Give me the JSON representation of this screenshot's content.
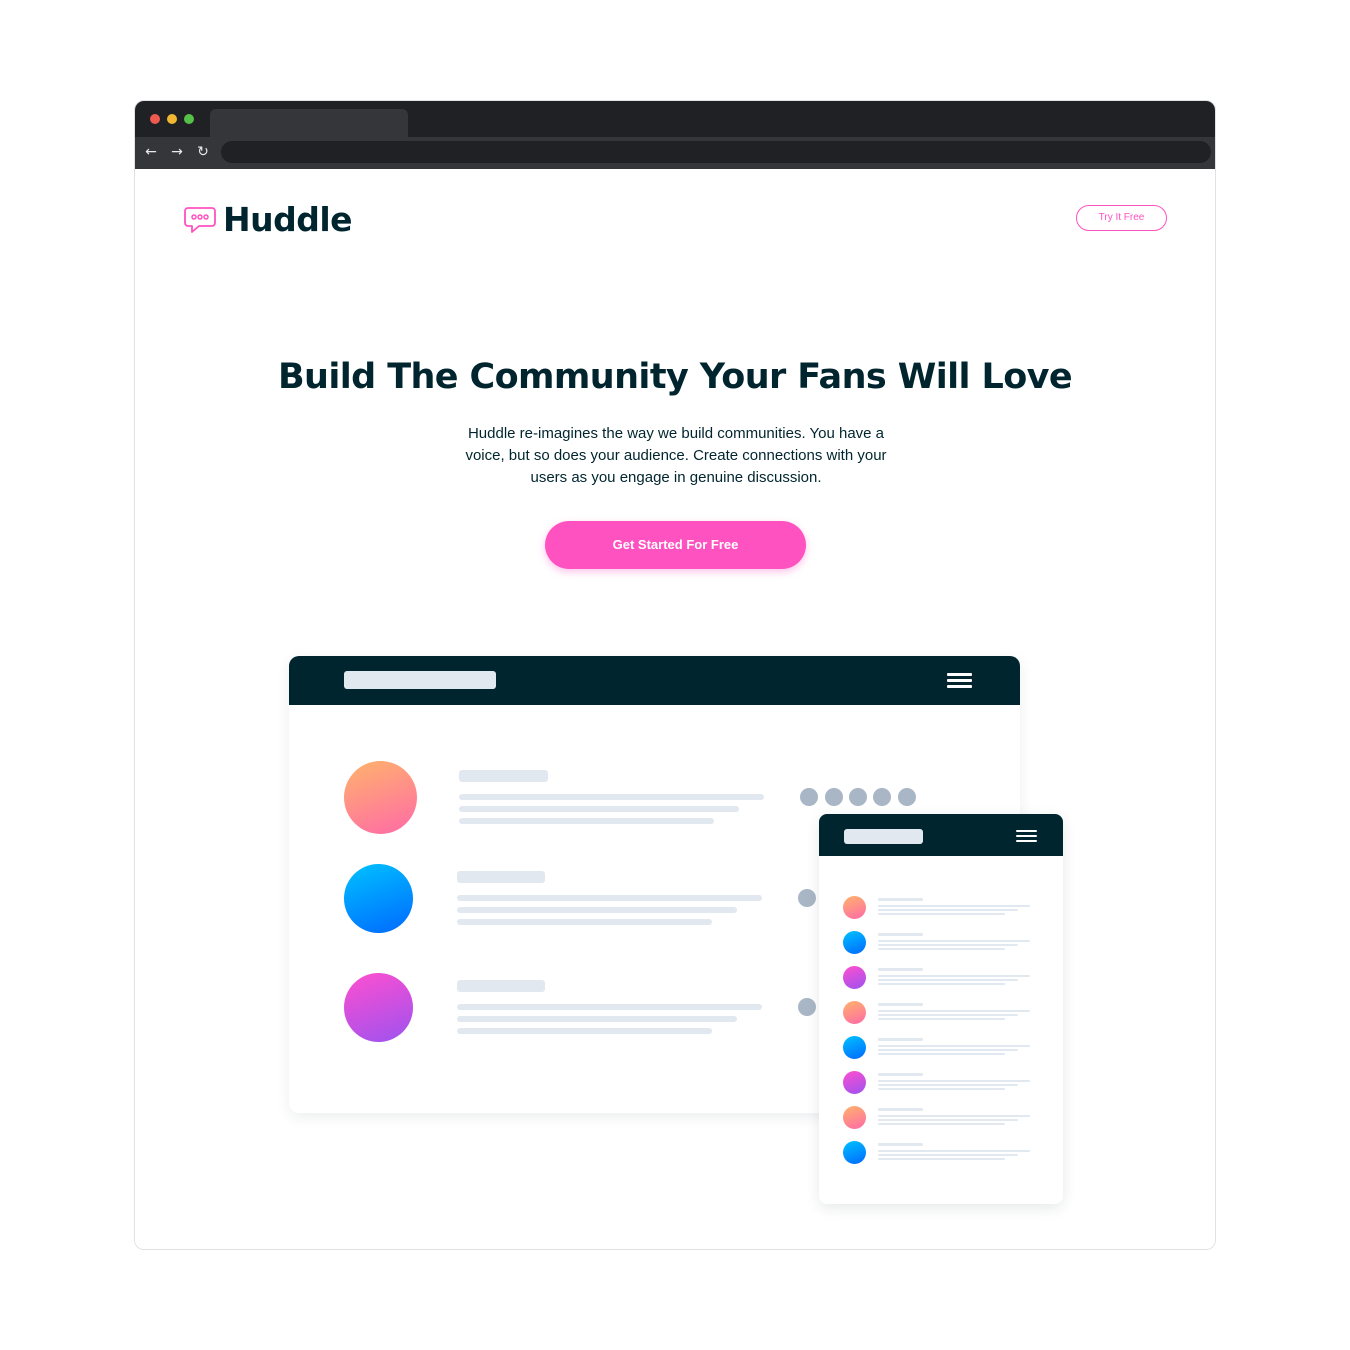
{
  "brand": {
    "name": "Huddle",
    "accent": "#ff52c1",
    "dark": "#00252e",
    "icon": "chat-bubble-icon"
  },
  "header": {
    "cta_label": "Try It Free"
  },
  "hero": {
    "title": "Build The Community Your Fans Will Love",
    "text": "Huddle re-imagines the way we build communities. You have a voice, but so does your audience. Create connections with your users as you engage in genuine discussion.",
    "button_label": "Get Started For Free"
  },
  "browser": {
    "icons": [
      "back-arrow-icon",
      "forward-arrow-icon",
      "reload-icon"
    ]
  },
  "mockup": {
    "desktop_avatars": [
      "orange",
      "blue",
      "purple"
    ],
    "mobile_avatars": [
      "orange",
      "blue",
      "purple",
      "orange",
      "blue",
      "purple",
      "orange",
      "blue"
    ]
  }
}
